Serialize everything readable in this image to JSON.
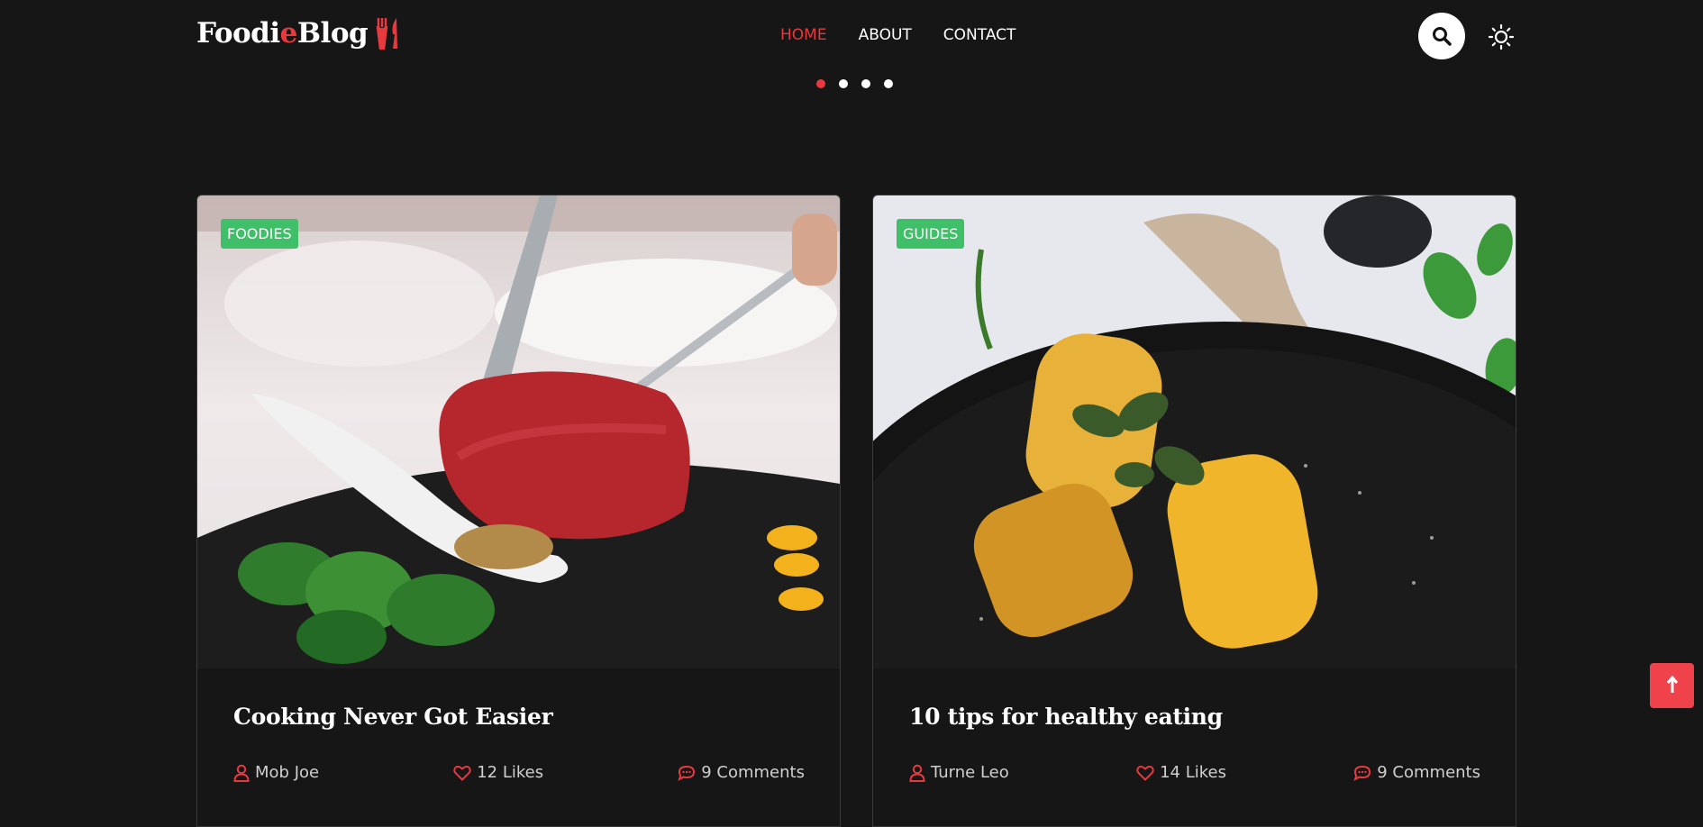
{
  "header": {
    "logo_part1": "Food",
    "logo_accent": "i",
    "logo_part2": "e",
    "logo_part3": " Blog",
    "nav": [
      {
        "label": "HOME",
        "active": true
      },
      {
        "label": "ABOUT",
        "active": false
      },
      {
        "label": "CONTACT",
        "active": false
      }
    ],
    "search_icon": "search-icon",
    "theme_icon": "sun-icon"
  },
  "slider": {
    "dot_count": 4,
    "active_index": 0
  },
  "posts": [
    {
      "category": "FOODIES",
      "title": "Cooking Never Got Easier",
      "author": "Mob Joe",
      "likes": "12 Likes",
      "comments": "9 Comments"
    },
    {
      "category": "GUIDES",
      "title": "10 tips for healthy eating",
      "author": "Turne Leo",
      "likes": "14 Likes",
      "comments": "9 Comments"
    }
  ],
  "colors": {
    "accent": "#e8393e",
    "badge": "#3fbf68",
    "background": "#161616"
  },
  "scroll_top_icon": "arrow-up-icon"
}
